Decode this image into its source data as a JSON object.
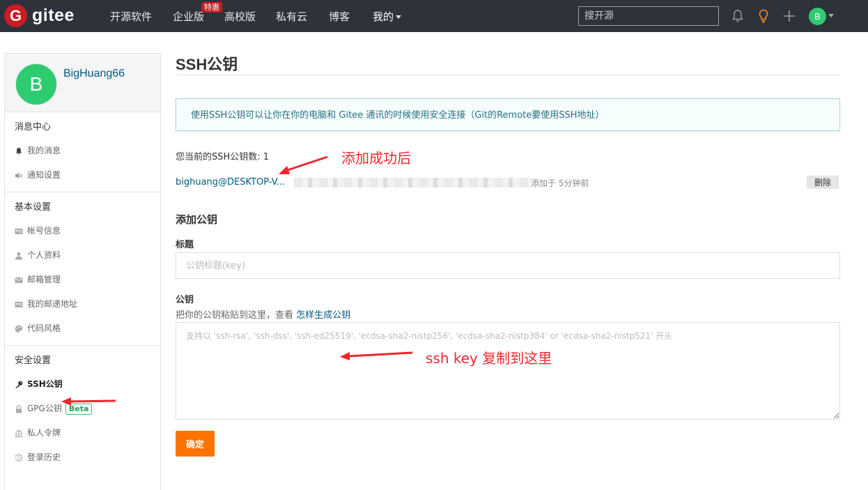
{
  "header": {
    "logo_letter": "G",
    "logo_text": "gitee",
    "nav": {
      "open_source": "开源软件",
      "enterprise": "企业版",
      "enterprise_badge": "特惠",
      "university": "高校版",
      "private_cloud": "私有云",
      "blog": "博客",
      "mine": "我的"
    },
    "search_placeholder": "搜开源",
    "avatar_letter": "B"
  },
  "sidebar": {
    "avatar_letter": "B",
    "username": "BigHuang66",
    "sections": {
      "messages": {
        "title": "消息中心",
        "items": [
          "我的消息",
          "通知设置"
        ]
      },
      "basic": {
        "title": "基本设置",
        "items": [
          "帐号信息",
          "个人资料",
          "邮箱管理",
          "我的邮递地址",
          "代码风格"
        ]
      },
      "security": {
        "title": "安全设置",
        "items": [
          "SSH公钥",
          "GPG公钥",
          "私人令牌",
          "登录历史"
        ],
        "beta_badge": "Beta"
      }
    }
  },
  "main": {
    "page_title": "SSH公钥",
    "info": "使用SSH公钥可以让你在你的电脑和 Gitee 通讯的时候使用安全连接（Git的Remote要使用SSH地址）",
    "key_count": "您当前的SSH公钥数: 1",
    "key": {
      "title": "bighuang@DESKTOP-V...",
      "added": "添加于 5分钟前",
      "delete_label": "删除"
    },
    "add_section_title": "添加公钥",
    "title_label": "标题",
    "title_placeholder": "公钥标题(key)",
    "key_label": "公钥",
    "hint_prefix": "把你的公钥粘贴到这里，查看 ",
    "hint_link": "怎样生成公钥",
    "key_placeholder": "支持以 'ssh-rsa', 'ssh-dss', 'ssh-ed25519', 'ecdsa-sha2-nistp256', 'ecdsa-sha2-nistp384' or 'ecdsa-sha2-nistp521' 开头",
    "submit_label": "确定"
  },
  "annotations": {
    "added_success": "添加成功后",
    "paste_here": "ssh key 复制到这里"
  },
  "colors": {
    "topbar": "#2d323b",
    "brand_red": "#c71d23",
    "avatar_green": "#2ecc71",
    "link_blue": "#005980",
    "submit_orange": "#fe7300",
    "annotation_red": "#f0262c"
  }
}
